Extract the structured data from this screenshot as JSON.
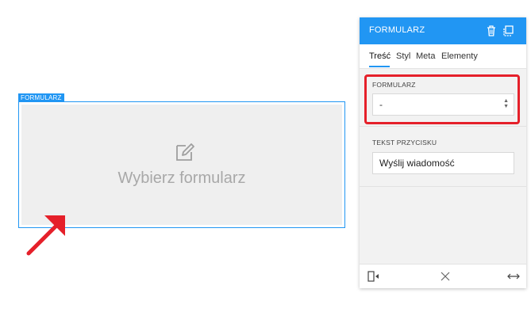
{
  "canvas": {
    "block_tag": "FORMULARZ",
    "placeholder_text": "Wybierz formularz",
    "block_icon": "edit-icon"
  },
  "panel": {
    "title": "FORMULARZ",
    "header_icons": [
      "trash-icon",
      "duplicate-icon"
    ],
    "tabs": [
      {
        "label": "Treść",
        "active": true
      },
      {
        "label": "Styl",
        "active": false
      },
      {
        "label": "Meta",
        "active": false
      },
      {
        "label": "Elementy",
        "active": false
      }
    ],
    "form_field": {
      "label": "FORMULARZ",
      "selected_value": "-",
      "options": [
        "-"
      ]
    },
    "button_text_field": {
      "label": "TEKST PRZYCISKU",
      "value": "Wyślij wiadomość"
    },
    "footer_icons": [
      "collapse-panel-icon",
      "close-icon",
      "expand-width-icon"
    ]
  },
  "colors": {
    "accent": "#2196f3",
    "highlight": "#e5202a",
    "panel_bg": "#f2f2f2"
  }
}
